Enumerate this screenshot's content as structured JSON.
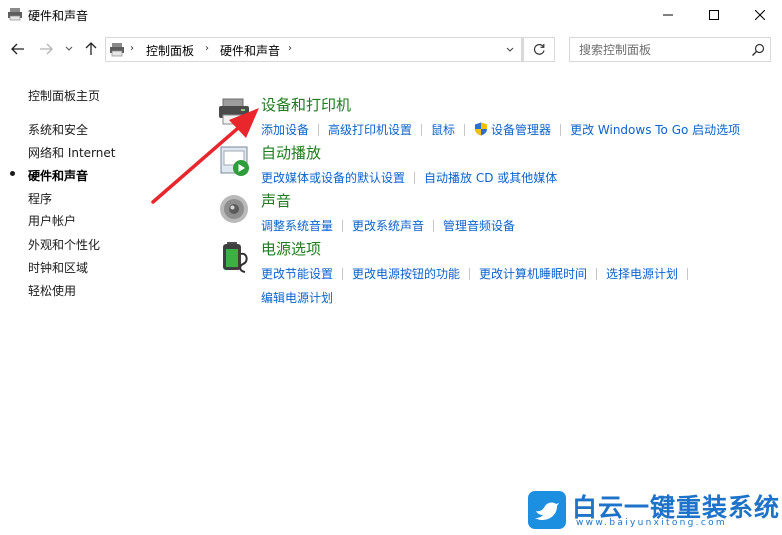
{
  "window": {
    "title": "硬件和声音",
    "controls": [
      "minimize-icon",
      "maximize-icon",
      "close-icon"
    ]
  },
  "address_bar": {
    "breadcrumbs": [
      "控制面板",
      "硬件和声音"
    ],
    "search_placeholder": "搜索控制面板"
  },
  "sidebar": {
    "home": "控制面板主页",
    "items": [
      {
        "label": "系统和安全",
        "active": false
      },
      {
        "label": "网络和 Internet",
        "active": false
      },
      {
        "label": "硬件和声音",
        "active": true
      },
      {
        "label": "程序",
        "active": false
      },
      {
        "label": "用户帐户",
        "active": false
      },
      {
        "label": "外观和个性化",
        "active": false
      },
      {
        "label": "时钟和区域",
        "active": false
      },
      {
        "label": "轻松使用",
        "active": false
      }
    ]
  },
  "categories": [
    {
      "title": "设备和打印机",
      "icon": "printer-icon",
      "links": [
        "添加设备",
        "高级打印机设置",
        "鼠标",
        "设备管理器",
        "更改 Windows To Go 启动选项"
      ]
    },
    {
      "title": "自动播放",
      "icon": "autoplay-icon",
      "links": [
        "更改媒体或设备的默认设置",
        "自动播放 CD 或其他媒体"
      ]
    },
    {
      "title": "声音",
      "icon": "speaker-icon",
      "links": [
        "调整系统音量",
        "更改系统声音",
        "管理音频设备"
      ]
    },
    {
      "title": "电源选项",
      "icon": "battery-icon",
      "links": [
        "更改节能设置",
        "更改电源按钮的功能",
        "更改计算机睡眠时间",
        "选择电源计划",
        "编辑电源计划"
      ]
    }
  ],
  "colors": {
    "category_title": "#1e7c1e",
    "link": "#0b63ce",
    "annotation_arrow": "#e8262b",
    "watermark": "#1d73c9"
  },
  "watermark": {
    "brand": "白云一键重装系统",
    "url": "www.baiyunxitong.com"
  }
}
